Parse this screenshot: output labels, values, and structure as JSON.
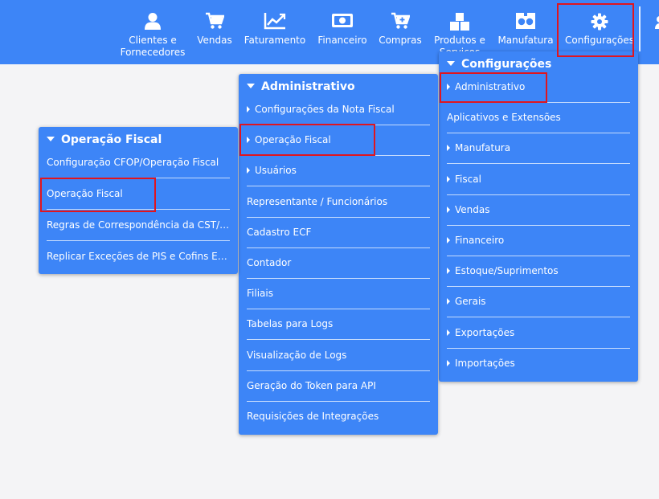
{
  "topnav": {
    "items": [
      {
        "label": "Clientes e Fornecedores",
        "icon": "user-icon"
      },
      {
        "label": "Vendas",
        "icon": "cart-icon"
      },
      {
        "label": "Faturamento",
        "icon": "chart-line-icon"
      },
      {
        "label": "Financeiro",
        "icon": "money-icon"
      },
      {
        "label": "Compras",
        "icon": "cart-plus-icon"
      },
      {
        "label": "Produtos e Serviços",
        "icon": "cubes-icon"
      },
      {
        "label": "Manufatura",
        "icon": "industry-icon"
      },
      {
        "label": "Configurações",
        "icon": "gear-icon"
      }
    ]
  },
  "menus": {
    "configuracoes": {
      "title": "Configurações",
      "items": [
        {
          "label": "Administrativo",
          "arrow": true
        },
        {
          "label": "Aplicativos e Extensões",
          "arrow": false
        },
        {
          "label": "Manufatura",
          "arrow": true
        },
        {
          "label": "Fiscal",
          "arrow": true
        },
        {
          "label": "Vendas",
          "arrow": true
        },
        {
          "label": "Financeiro",
          "arrow": true
        },
        {
          "label": "Estoque/Suprimentos",
          "arrow": true
        },
        {
          "label": "Gerais",
          "arrow": true
        },
        {
          "label": "Exportações",
          "arrow": true
        },
        {
          "label": "Importações",
          "arrow": true
        }
      ]
    },
    "administrativo": {
      "title": "Administrativo",
      "items": [
        {
          "label": "Configurações da Nota Fiscal",
          "arrow": true
        },
        {
          "label": "Operação Fiscal",
          "arrow": true
        },
        {
          "label": "Usuários",
          "arrow": true
        },
        {
          "label": "Representante / Funcionários",
          "arrow": false
        },
        {
          "label": "Cadastro ECF",
          "arrow": false
        },
        {
          "label": "Contador",
          "arrow": false
        },
        {
          "label": "Filiais",
          "arrow": false
        },
        {
          "label": "Tabelas para Logs",
          "arrow": false
        },
        {
          "label": "Visualização de Logs",
          "arrow": false
        },
        {
          "label": "Geração do Token para API",
          "arrow": false
        },
        {
          "label": "Requisições de Integrações",
          "arrow": false
        }
      ]
    },
    "operacao_fiscal": {
      "title": "Operação Fiscal",
      "items": [
        {
          "label": "Configuração CFOP/Operação Fiscal",
          "arrow": false
        },
        {
          "label": "Operação Fiscal",
          "arrow": false
        },
        {
          "label": "Regras de Correspondência da CST/CSOSN",
          "arrow": false
        },
        {
          "label": "Replicar Exceções de PIS e Cofins Entre Filiais",
          "arrow": false
        }
      ]
    }
  },
  "colors": {
    "primary": "#3d85f7",
    "highlight": "#e0151f",
    "background": "#f4f4f6"
  }
}
